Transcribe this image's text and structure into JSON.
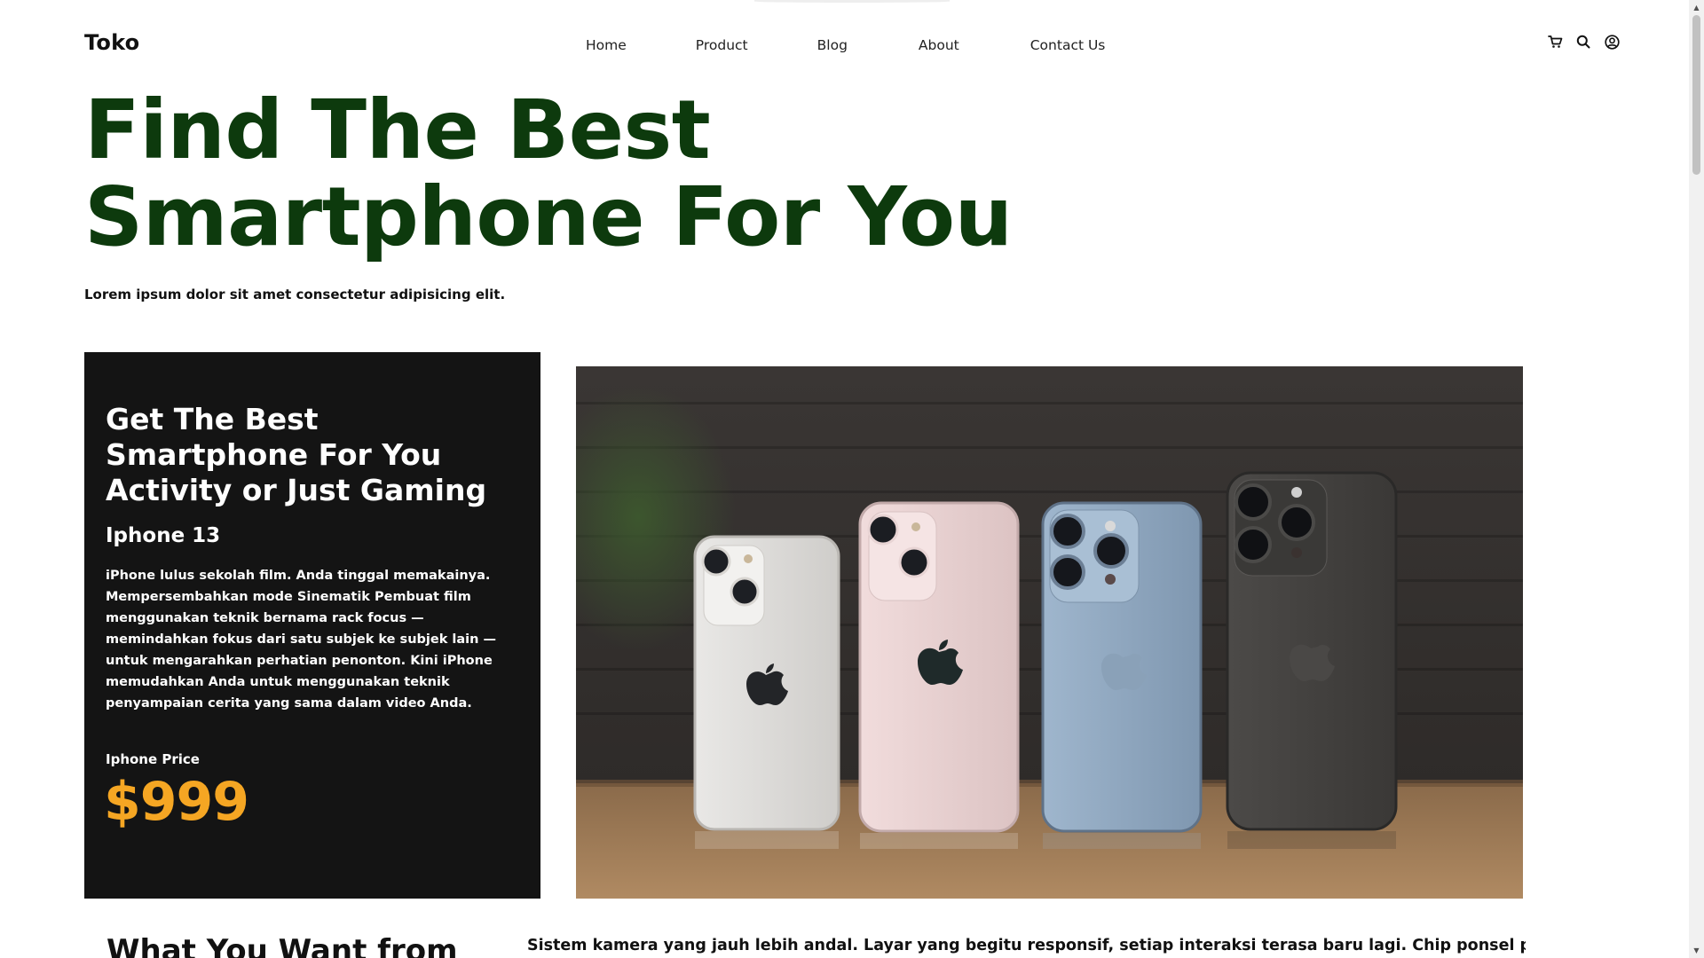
{
  "nav": {
    "brand": "Toko",
    "links": [
      "Home",
      "Product",
      "Blog",
      "About",
      "Contact Us"
    ],
    "icons": [
      "cart-icon",
      "search-icon",
      "user-icon"
    ]
  },
  "hero": {
    "title_line1": "Find The Best",
    "title_line2": "Smartphone For You",
    "subtitle": "Lorem ipsum dolor sit amet consectetur adipisicing elit."
  },
  "promo": {
    "heading": "Get The Best Smartphone For You Activity or Just Gaming",
    "model": "Iphone 13",
    "description": "iPhone lulus sekolah film. Anda tinggal memakainya. Mempersembahkan mode Sinematik Pembuat film menggunakan teknik bernama rack focus — memindahkan fokus dari satu subjek ke subjek lain — untuk mengarahkan perhatian penonton. Kini iPhone memudahkan Anda untuk menggunakan teknik penyampaian cerita yang sama dalam video Anda.",
    "price_label": "Iphone Price",
    "price": "$999"
  },
  "section": {
    "heading": "What You Want from",
    "text": "Sistem kamera yang jauh lebih andal. Layar yang begitu responsif, setiap interaksi terasa baru lagi. Chip ponsel pintar paling cepat di"
  },
  "colors": {
    "hero_title": "#0d3a0d",
    "promo_bg": "#141414",
    "price": "#f5a623"
  }
}
